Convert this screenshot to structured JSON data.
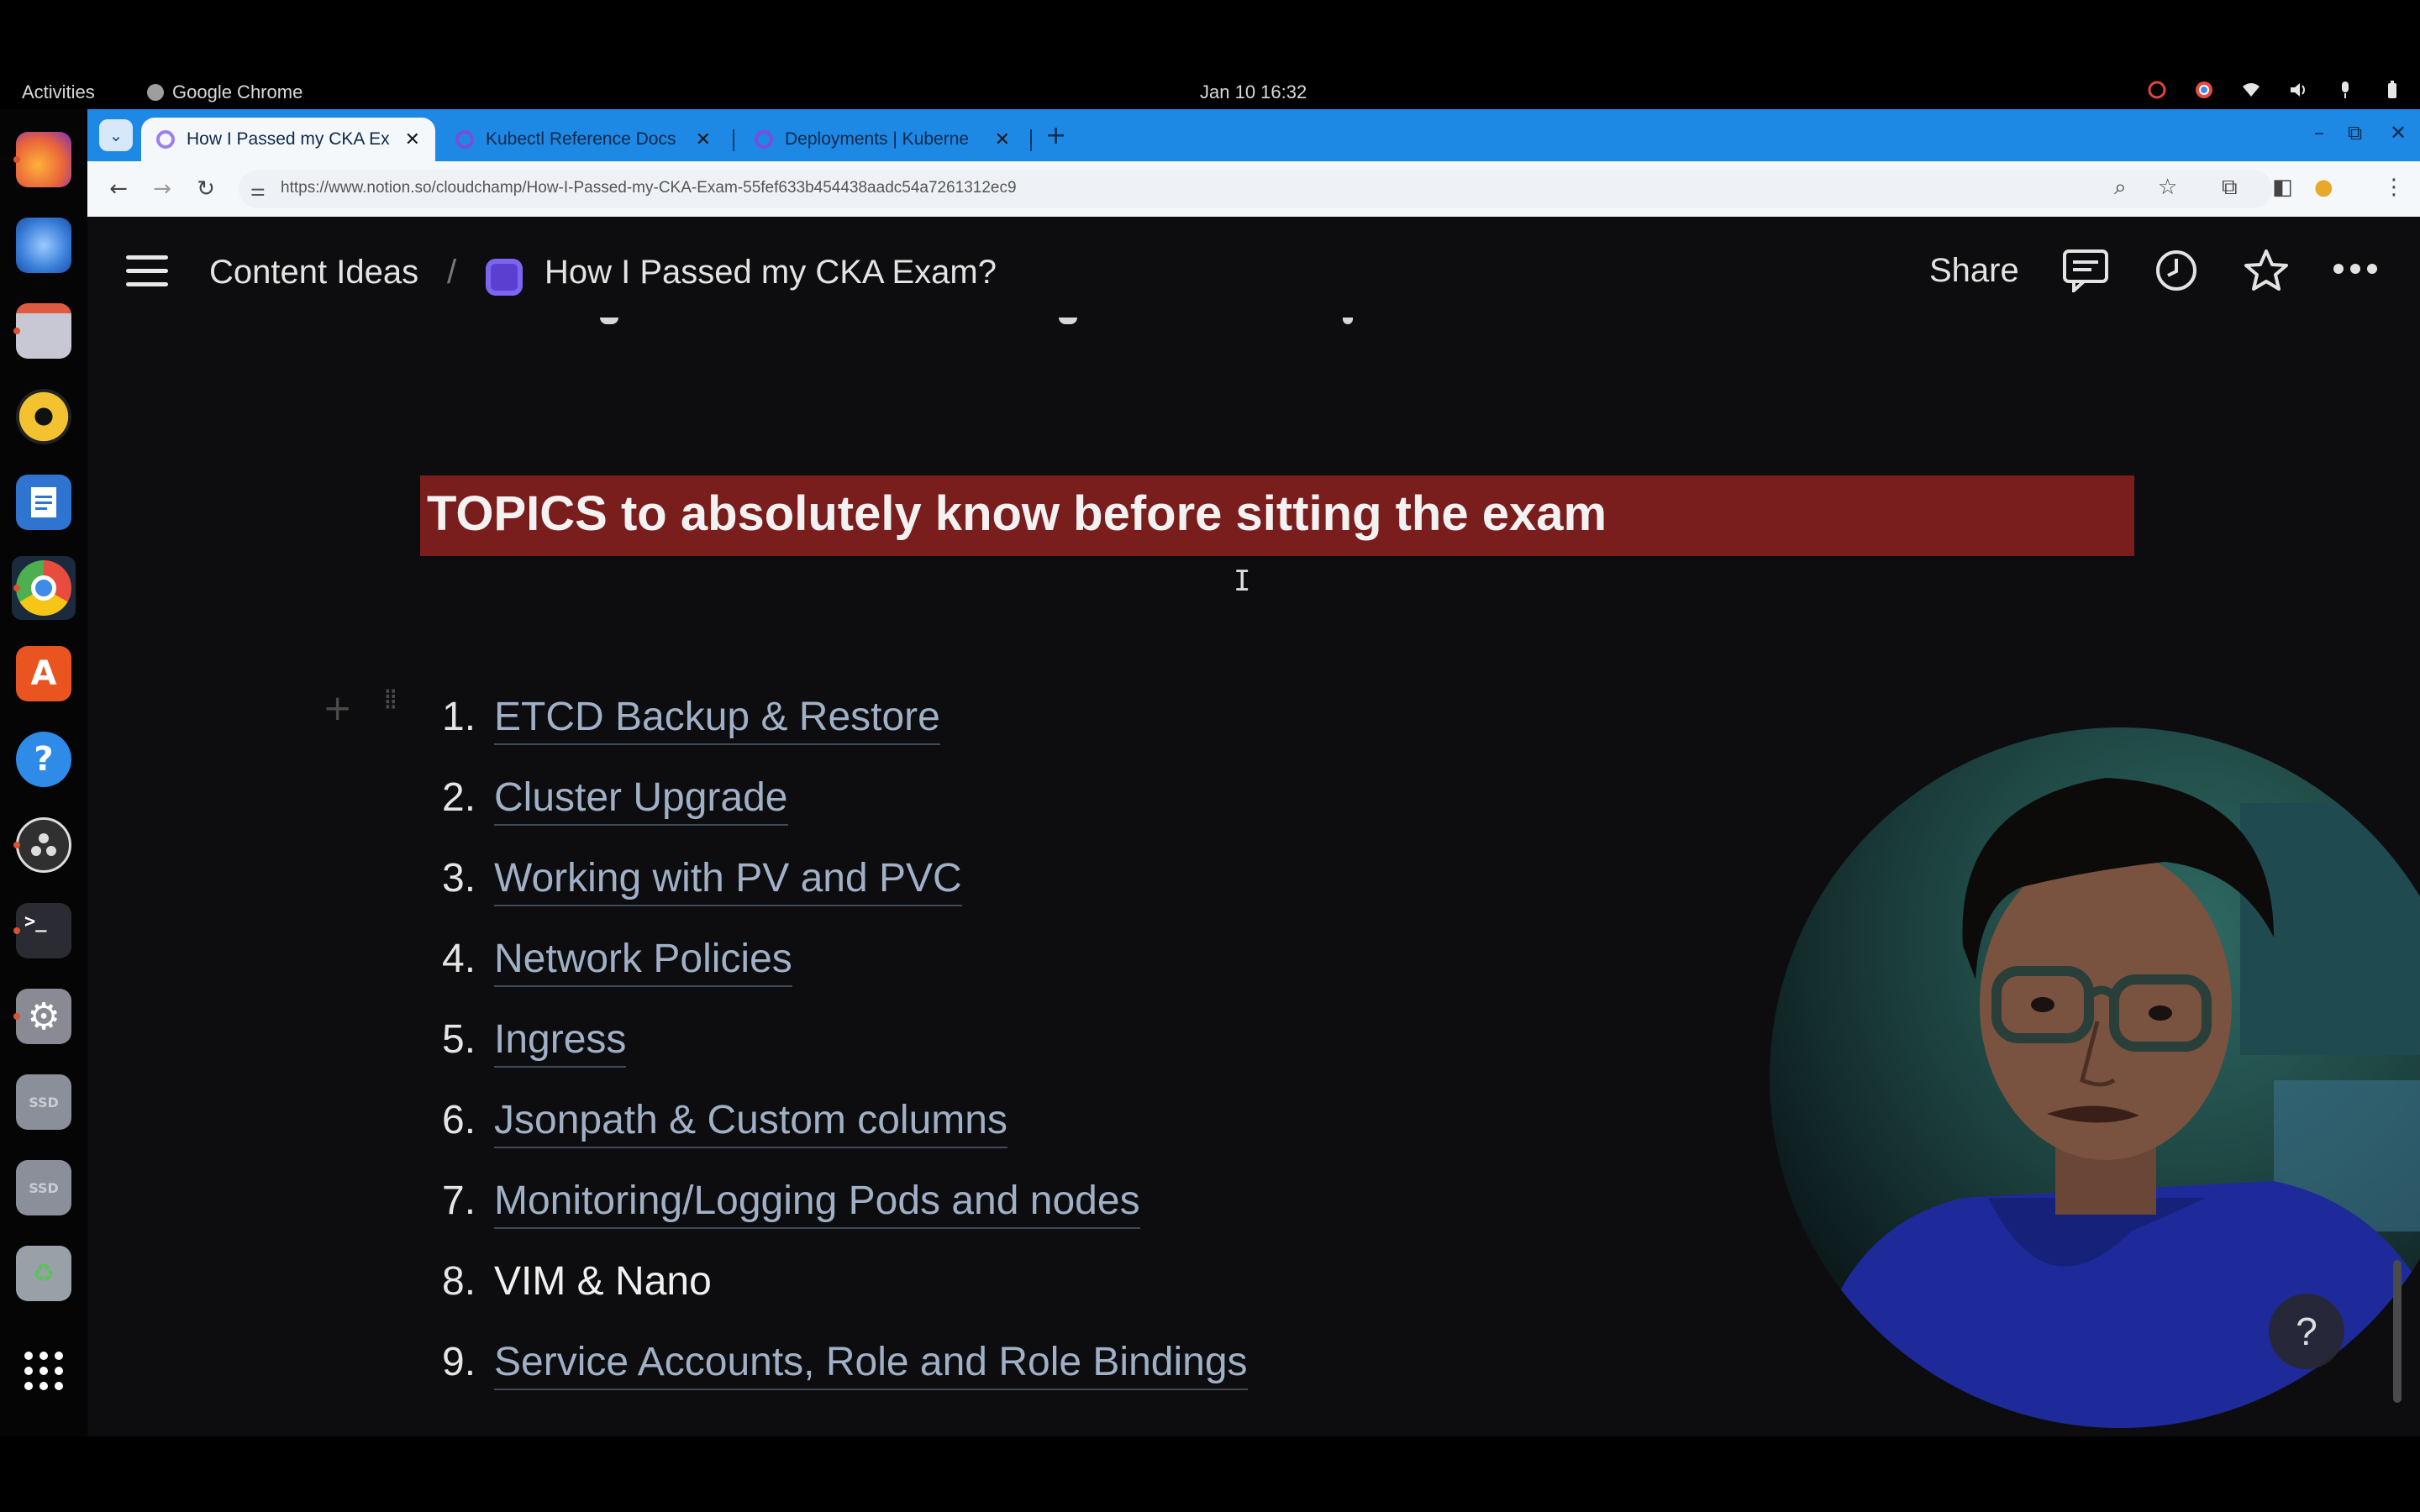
{
  "system_bar": {
    "activities": "Activities",
    "app_name": "Google Chrome",
    "clock": "Jan 10  16:32"
  },
  "dock": {
    "items": [
      {
        "name": "firefox-icon",
        "color": "#e8643a"
      },
      {
        "name": "thunderbird-icon",
        "color": "#3a7fd9"
      },
      {
        "name": "files-icon",
        "color": "#b8b8c8"
      },
      {
        "name": "rhythmbox-icon",
        "color": "#f2c230"
      },
      {
        "name": "writer-icon",
        "color": "#2f74d1"
      },
      {
        "name": "chrome-icon",
        "color": "#4caf50"
      },
      {
        "name": "app-center-icon",
        "color": "#e95420"
      },
      {
        "name": "help-icon",
        "color": "#2e8be8"
      },
      {
        "name": "obs-icon",
        "color": "#303030"
      },
      {
        "name": "terminal-icon",
        "color": "#2b2b33"
      },
      {
        "name": "settings-icon",
        "color": "#8a8a94"
      },
      {
        "name": "ssd-drive-icon",
        "color": "#8a8f99"
      },
      {
        "name": "ssd-drive-icon",
        "color": "#8a8f99"
      },
      {
        "name": "trash-icon",
        "color": "#9aa0a8"
      },
      {
        "name": "show-apps-icon",
        "color": "#ffffff"
      }
    ]
  },
  "browser": {
    "tabs": [
      {
        "title": "How I Passed my CKA Ex",
        "active": true
      },
      {
        "title": "Kubectl Reference Docs",
        "active": false
      },
      {
        "title": "Deployments | Kuberne",
        "active": false
      }
    ],
    "url": "https://www.notion.so/cloudchamp/How-I-Passed-my-CKA-Exam-55fef633b454438aadc54a7261312ec9"
  },
  "notion": {
    "breadcrumb_parent": "Content Ideas",
    "breadcrumb_separator": "/",
    "page_title": "How I Passed my CKA Exam?",
    "share_label": "Share",
    "heading": "TOPICS to absolutely know before sitting the exam",
    "topics": [
      {
        "num": "1.",
        "text": "ETCD Backup & Restore",
        "link": true
      },
      {
        "num": "2.",
        "text": "Cluster Upgrade",
        "link": true
      },
      {
        "num": "3.",
        "text": "Working with PV and PVC",
        "link": true
      },
      {
        "num": "4.",
        "text": "Network Policies",
        "link": true
      },
      {
        "num": "5.",
        "text": "Ingress",
        "link": true
      },
      {
        "num": "6.",
        "text": "Jsonpath & Custom columns",
        "link": true
      },
      {
        "num": "7.",
        "text": "Monitoring/Logging Pods and nodes",
        "link": true
      },
      {
        "num": "8.",
        "text": "VIM & Nano",
        "link": false
      },
      {
        "num": "9.",
        "text": "Service Accounts, Role and Role Bindings",
        "link": true
      }
    ],
    "help_label": "?"
  },
  "colors": {
    "heading_bg": "#7a1d1d",
    "link_text": "#9fb0c7",
    "chrome_tabstrip": "#1e88e5"
  }
}
